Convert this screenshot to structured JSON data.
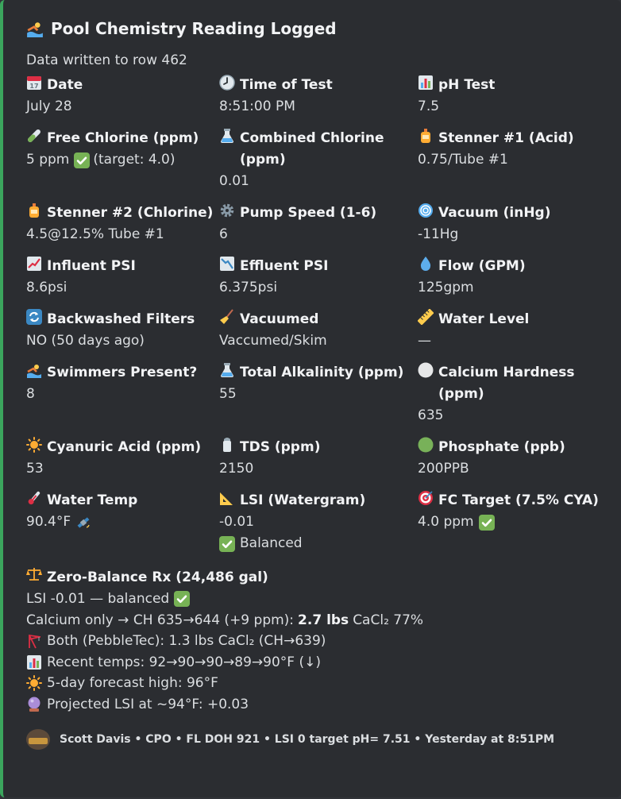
{
  "embed": {
    "accent_color": "#3ba55d",
    "title_icon": "swimmer-icon",
    "title": "Pool Chemistry Reading Logged",
    "description": "Data written to row 462"
  },
  "fields": [
    {
      "icon": "calendar-icon",
      "name": "Date",
      "value": "July 28"
    },
    {
      "icon": "clock-icon",
      "name": "Time of Test",
      "value": "8:51:00 PM"
    },
    {
      "icon": "bar-chart-icon",
      "name": "pH Test",
      "value": "7.5"
    },
    {
      "icon": "test-tube-icon",
      "name": "Free Chlorine (ppm)",
      "value": "5 ppm",
      "value_icon": "check-mark-icon",
      "value_suffix": "(target: 4.0)"
    },
    {
      "icon": "flask-icon",
      "name": "Combined Chlorine (ppm)",
      "value": "0.01"
    },
    {
      "icon": "bottle-icon",
      "name": "Stenner #1 (Acid)",
      "value": "0.75/Tube #1"
    },
    {
      "icon": "bottle-icon",
      "name": "Stenner #2 (Chlorine)",
      "value": "4.5@12.5% Tube #1"
    },
    {
      "icon": "gear-icon",
      "name": "Pump Speed (1-6)",
      "value": "6"
    },
    {
      "icon": "cyclone-icon",
      "name": "Vacuum (inHg)",
      "value": "-11Hg"
    },
    {
      "icon": "chart-increasing-icon",
      "name": "Influent PSI",
      "value": "8.6psi"
    },
    {
      "icon": "chart-decreasing-icon",
      "name": "Effluent PSI",
      "value": "6.375psi"
    },
    {
      "icon": "droplet-icon",
      "name": "Flow (GPM)",
      "value": "125gpm"
    },
    {
      "icon": "refresh-icon",
      "name": "Backwashed Filters",
      "value": "NO (50 days ago)"
    },
    {
      "icon": "broom-icon",
      "name": "Vacuumed",
      "value": "Vaccumed/Skim"
    },
    {
      "icon": "ruler-icon",
      "name": "Water Level",
      "value": "—"
    },
    {
      "icon": "swimmer-icon",
      "name": "Swimmers Present?",
      "value": "8"
    },
    {
      "icon": "flask-icon",
      "name": "Total Alkalinity (ppm)",
      "value": "55"
    },
    {
      "icon": "white-circle-icon",
      "name": "Calcium Hardness (ppm)",
      "value": "635"
    },
    {
      "icon": "sun-icon",
      "name": "Cyanuric Acid (ppm)",
      "value": "53"
    },
    {
      "icon": "salt-shaker-icon",
      "name": "TDS (ppm)",
      "value": "2150"
    },
    {
      "icon": "green-circle-icon",
      "name": "Phosphate (ppb)",
      "value": "200PPB"
    },
    {
      "icon": "thermometer-icon",
      "name": "Water Temp",
      "value": "90.4°F",
      "value_icon": "satellite-icon"
    },
    {
      "icon": "triangle-ruler-icon",
      "name": "LSI (Watergram)",
      "value": "-0.01",
      "value2_icon": "check-mark-icon",
      "value2": "Balanced"
    },
    {
      "icon": "target-icon",
      "name": "FC Target (7.5% CYA)",
      "value": "4.0 ppm",
      "value_icon": "check-mark-icon"
    }
  ],
  "rx": {
    "icon": "balance-scale-icon",
    "name": "Zero-Balance Rx (24,486 gal)",
    "line1": "LSI -0.01 — balanced",
    "line1_icon": "check-mark-icon",
    "line2_pre": "Calcium only → CH 635→644 (+9 ppm):",
    "line2_bold": "2.7 lbs",
    "line2_post": "CaCl₂ 77%",
    "line3_icon": "crane-icon",
    "line3": "Both (PebbleTec): 1.3 lbs CaCl₂ (CH→639)",
    "line4_icon": "bar-chart-icon",
    "line4": "Recent temps: 92→90→90→89→90°F (↓)",
    "line5_icon": "sun-icon",
    "line5": "5-day forecast high: 96°F",
    "line6_icon": "crystal-ball-icon",
    "line6": "Projected LSI at ~94°F: +0.03"
  },
  "footer": {
    "text": "Scott Davis • CPO • FL DOH 921 • LSI 0 target pH= 7.51 • Yesterday at 8:51PM"
  }
}
